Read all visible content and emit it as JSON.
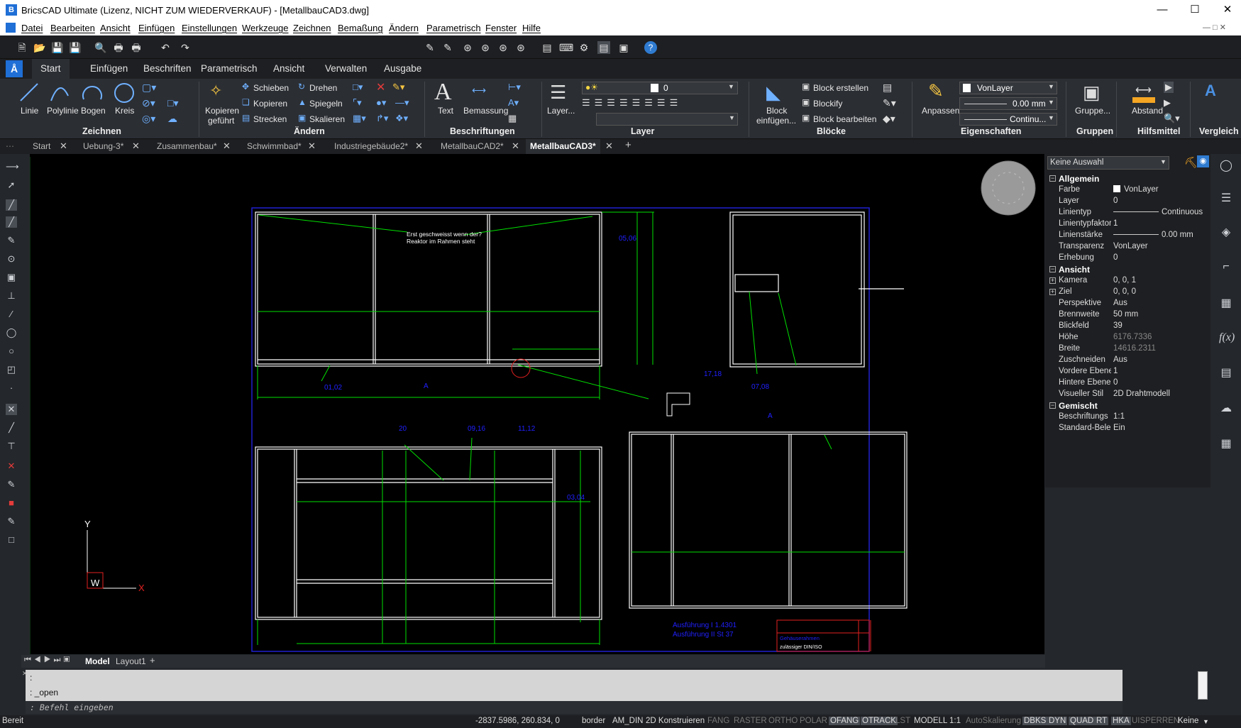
{
  "window": {
    "title": "BricsCAD Ultimate (Lizenz, NICHT ZUM WIEDERVERKAUF) - [MetallbauCAD3.dwg]"
  },
  "menu": [
    "Datei",
    "Bearbeiten",
    "Ansicht",
    "Einfügen",
    "Einstellungen",
    "Werkzeuge",
    "Zeichnen",
    "Bemaßung",
    "Ändern",
    "Parametrisch",
    "Fenster",
    "Hilfe"
  ],
  "qat": {
    "layer_value": "0"
  },
  "ribbon_tabs": [
    "Start",
    "Einfügen",
    "Beschriften",
    "Parametrisch",
    "Ansicht",
    "Verwalten",
    "Ausgabe"
  ],
  "ribbon": {
    "zeichnen": {
      "group": "Zeichnen",
      "linie": "Linie",
      "polylinie": "Polylinie",
      "bogen": "Bogen",
      "kreis": "Kreis"
    },
    "aendern": {
      "group": "Ändern",
      "kopieren_gefuehrt_1": "Kopieren",
      "kopieren_gefuehrt_2": "geführt",
      "schieben": "Schieben",
      "kopieren": "Kopieren",
      "strecken": "Strecken",
      "drehen": "Drehen",
      "spiegeln": "Spiegeln",
      "skalieren": "Skalieren"
    },
    "beschriftungen": {
      "group": "Beschriftungen",
      "text": "Text",
      "bemassung": "Bemassung"
    },
    "layer": {
      "group": "Layer",
      "layer_btn": "Layer...",
      "layer_value": "0"
    },
    "bloecke": {
      "group": "Blöcke",
      "block_einfuegen_1": "Block",
      "block_einfuegen_2": "einfügen...",
      "block_erstellen": "Block erstellen",
      "blockify": "Blockify",
      "block_bearbeiten": "Block bearbeiten"
    },
    "eigenschaften": {
      "group": "Eigenschaften",
      "anpassen": "Anpassen",
      "color": "VonLayer",
      "lineweight": "0.00 mm",
      "linetype": "Continu..."
    },
    "gruppen": {
      "group": "Gruppen",
      "gruppe": "Gruppe..."
    },
    "hilfsmittel": {
      "group": "Hilfsmittel",
      "abstand": "Abstand"
    },
    "vergleich": {
      "group": "Vergleich"
    }
  },
  "doc_tabs": [
    "Start",
    "Uebung-3*",
    "Zusammenbau*",
    "Schwimmbad*",
    "Industriegebäude2*",
    "MetallbauCAD2*",
    "MetallbauCAD3*"
  ],
  "drawing": {
    "note": [
      "Erst geschweisst wenn der?",
      "Reaktor im Rahmen steht"
    ],
    "dim_labels": {
      "d1": "05,06",
      "d2": "01,02",
      "d3": "A",
      "d4": "07,08",
      "d5": "20",
      "d6": "09,16",
      "d7": "11,12",
      "d8": "03,04",
      "d9": "17,18",
      "d10": "A"
    },
    "ausfuehrung": [
      "Ausführung I 1.4301",
      "Ausführung II St 37"
    ],
    "title_block": {
      "line1": "Gehäuserahmen",
      "line2": "zulässiger DIN/ISO"
    },
    "ucs": {
      "x": "X",
      "y": "Y",
      "w": "W"
    }
  },
  "properties": {
    "selection": "Keine Auswahl",
    "sections": [
      {
        "name": "Allgemein",
        "rows": [
          {
            "k": "Farbe",
            "v": "VonLayer"
          },
          {
            "k": "Layer",
            "v": "0"
          },
          {
            "k": "Linientyp",
            "v": "Continuous"
          },
          {
            "k": "Linientypfaktor",
            "v": "1"
          },
          {
            "k": "Linienstärke",
            "v": "0.00 mm"
          },
          {
            "k": "Transparenz",
            "v": "VonLayer"
          },
          {
            "k": "Erhebung",
            "v": "0"
          }
        ]
      },
      {
        "name": "Ansicht",
        "rows": [
          {
            "k": "Kamera",
            "v": "0, 0, 1"
          },
          {
            "k": "Ziel",
            "v": "0, 0, 0"
          },
          {
            "k": "Perspektive",
            "v": "Aus"
          },
          {
            "k": "Brennweite",
            "v": "50 mm"
          },
          {
            "k": "Blickfeld",
            "v": "39"
          },
          {
            "k": "Höhe",
            "v": "6176.7336"
          },
          {
            "k": "Breite",
            "v": "14616.2311"
          },
          {
            "k": "Zuschneiden",
            "v": "Aus"
          },
          {
            "k": "Vordere Ebene",
            "v": "1"
          },
          {
            "k": "Hintere Ebene",
            "v": "0"
          },
          {
            "k": "Visueller Stil",
            "v": "2D Drahtmodell"
          }
        ]
      },
      {
        "name": "Gemischt",
        "rows": [
          {
            "k": "Beschriftungs",
            "v": "1:1"
          },
          {
            "k": "Standard-Beleu",
            "v": "Ein"
          }
        ]
      }
    ]
  },
  "layout_tabs": {
    "model": "Model",
    "layout1": "Layout1"
  },
  "command": {
    "line1": ":",
    "line2": ": _open",
    "prompt": ": Befehl eingeben"
  },
  "status": {
    "ready": "Bereit",
    "coords": "-2837.5986, 260.834, 0",
    "items": [
      "border",
      "AM_DIN",
      "2D Konstruieren",
      "FANG",
      "RASTER",
      "ORTHO",
      "POLAR",
      "OFANG",
      "OTRACK",
      "LST",
      "MODELL",
      "1:1",
      "AutoSkalierung",
      "DBKS",
      "DYN",
      "QUAD",
      "RT",
      "HKA",
      "UISPERREN",
      "Keine"
    ]
  },
  "colors": {
    "accent": "#1f6fd6",
    "canvas": "#000000",
    "geometry": "#ffffff",
    "dimension": "#00ff00",
    "frame": "#0000ff"
  }
}
